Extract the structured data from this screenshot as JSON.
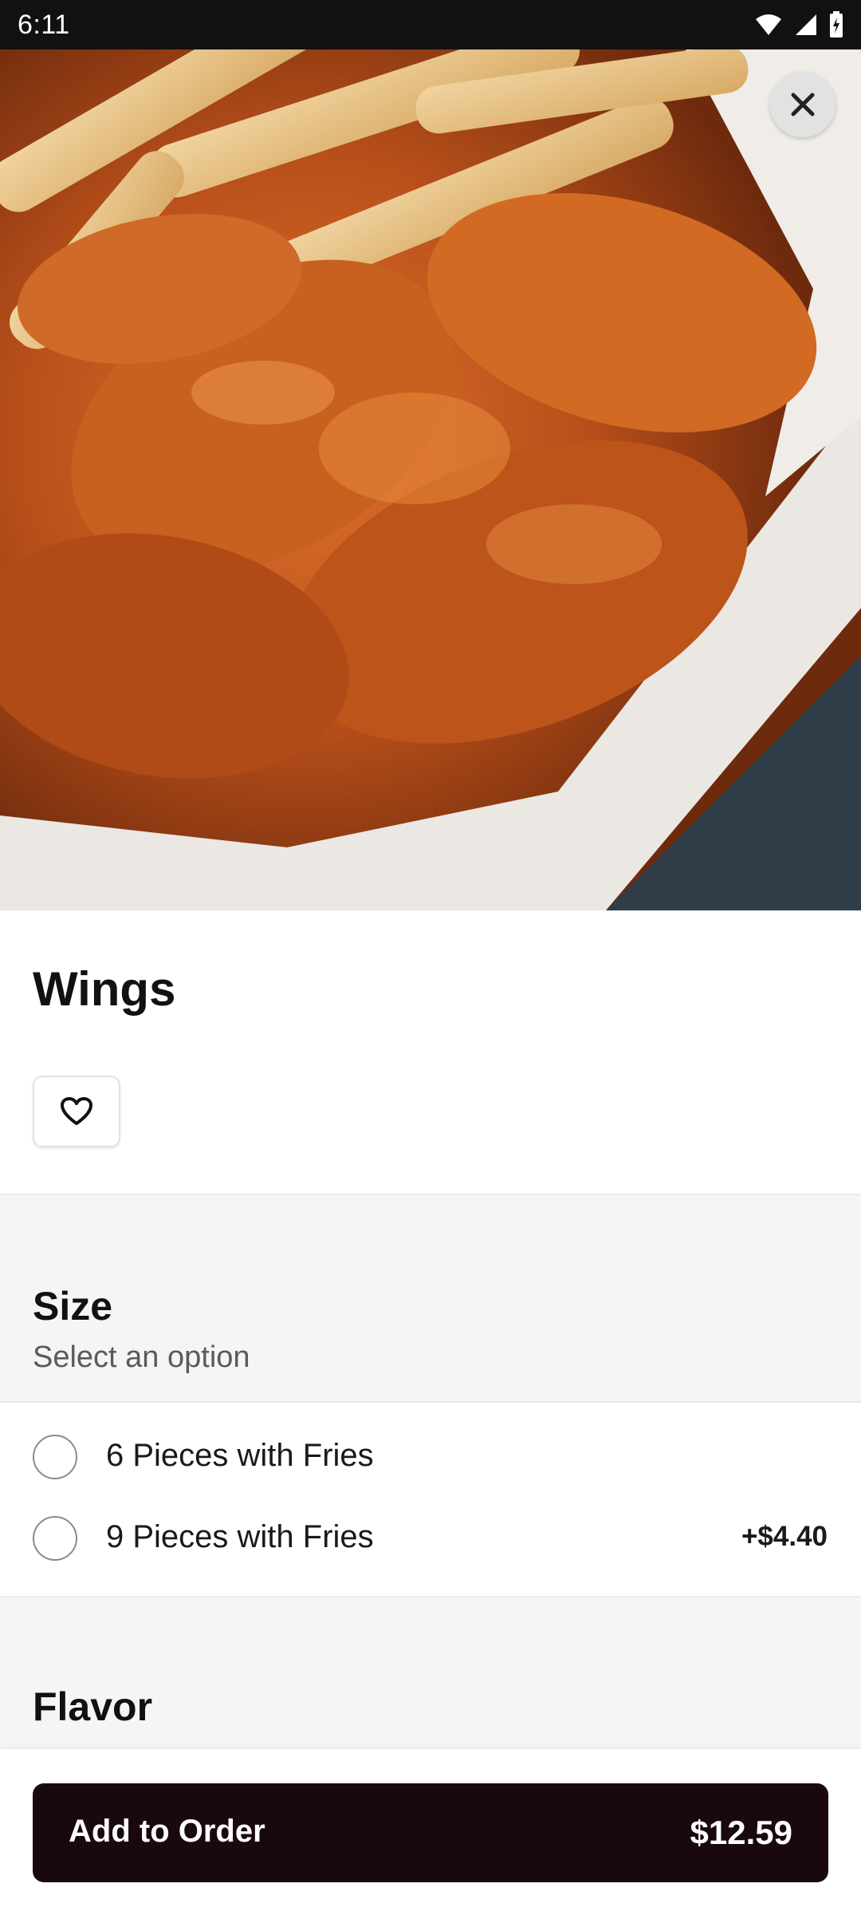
{
  "status_bar": {
    "time": "6:11"
  },
  "item": {
    "title": "Wings"
  },
  "sections": {
    "size": {
      "title": "Size",
      "subtitle": "Select an option",
      "options": [
        {
          "label": "6 Pieces with Fries",
          "price": ""
        },
        {
          "label": "9 Pieces with Fries",
          "price": "+$4.40"
        }
      ]
    },
    "flavor": {
      "title": "Flavor"
    }
  },
  "footer": {
    "button_label": "Add to Order",
    "button_price": "$12.59"
  },
  "colors": {
    "button_bg": "#1a0810",
    "section_bg": "#f5f5f5"
  },
  "icons": [
    "close-icon",
    "heart-icon",
    "wifi-icon",
    "signal-icon",
    "battery-icon"
  ]
}
